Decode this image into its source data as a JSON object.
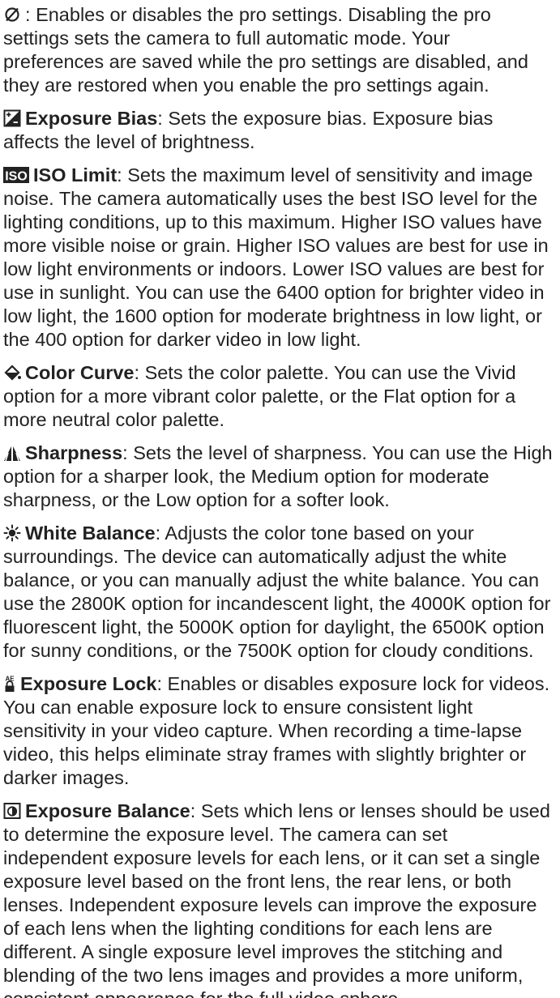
{
  "entries": [
    {
      "icon": "pro-settings-icon",
      "term": "",
      "separator": ": ",
      "description": "Enables or disables the pro settings. Disabling the pro settings sets the camera to full automatic mode. Your preferences are saved while the pro settings are disabled, and they are restored when you enable the pro settings again."
    },
    {
      "icon": "exposure-bias-icon",
      "term": "Exposure Bias",
      "separator": ": ",
      "description": "Sets the exposure bias. Exposure bias affects the level of brightness."
    },
    {
      "icon": "iso-icon",
      "term": "ISO Limit",
      "separator": ": ",
      "description": "Sets the maximum level of sensitivity and image noise. The camera automatically uses the best ISO level for the lighting conditions, up to this maximum. Higher ISO values have more visible noise or grain. Higher ISO values are best for use in low light environments or indoors. Lower ISO values are best for use in sunlight. You can use the 6400 option for brighter video in low light, the 1600 option for moderate brightness in low light, or the 400 option for darker video in low light."
    },
    {
      "icon": "color-curve-icon",
      "term": "Color Curve",
      "separator": ": ",
      "description": "Sets the color palette. You can use the Vivid option for a more vibrant color palette, or the Flat option for a more neutral color palette."
    },
    {
      "icon": "sharpness-icon",
      "term": "Sharpness",
      "separator": ": ",
      "description": "Sets the level of sharpness. You can use the High option for a sharper look, the Medium option for moderate sharpness, or the Low option for a softer look."
    },
    {
      "icon": "white-balance-icon",
      "term": "White Balance",
      "separator": ": ",
      "description": "Adjusts the color tone based on your surroundings. The device can automatically adjust the white balance, or you can manually adjust the white balance. You can use the 2800K option for incandescent light, the 4000K option for fluorescent light, the 5000K option for daylight, the 6500K option for sunny conditions, or the 7500K option for cloudy conditions."
    },
    {
      "icon": "exposure-lock-icon",
      "term": "Exposure Lock",
      "separator": ": ",
      "description": "Enables or disables exposure lock for videos. You can enable exposure lock to ensure consistent light sensitivity in your video capture. When recording a time-lapse video, this helps eliminate stray frames with slightly brighter or darker images."
    },
    {
      "icon": "exposure-balance-icon",
      "term": "Exposure Balance",
      "separator": ": ",
      "description": "Sets which lens or lenses should be used to determine the exposure level. The camera can set independent exposure levels for each lens, or it can set a single exposure level based on the front lens, the rear lens, or both lenses. Independent exposure levels can improve the exposure of each lens when the lighting conditions for each lens are different. A single exposure level improves the stitching and blending of the two lens images and provides a more uniform, consistent appearance for the full video sphere."
    }
  ],
  "icon_color": "#222222",
  "iso_icon_text": "ISO",
  "exposure_lock_icon_text": "AE"
}
